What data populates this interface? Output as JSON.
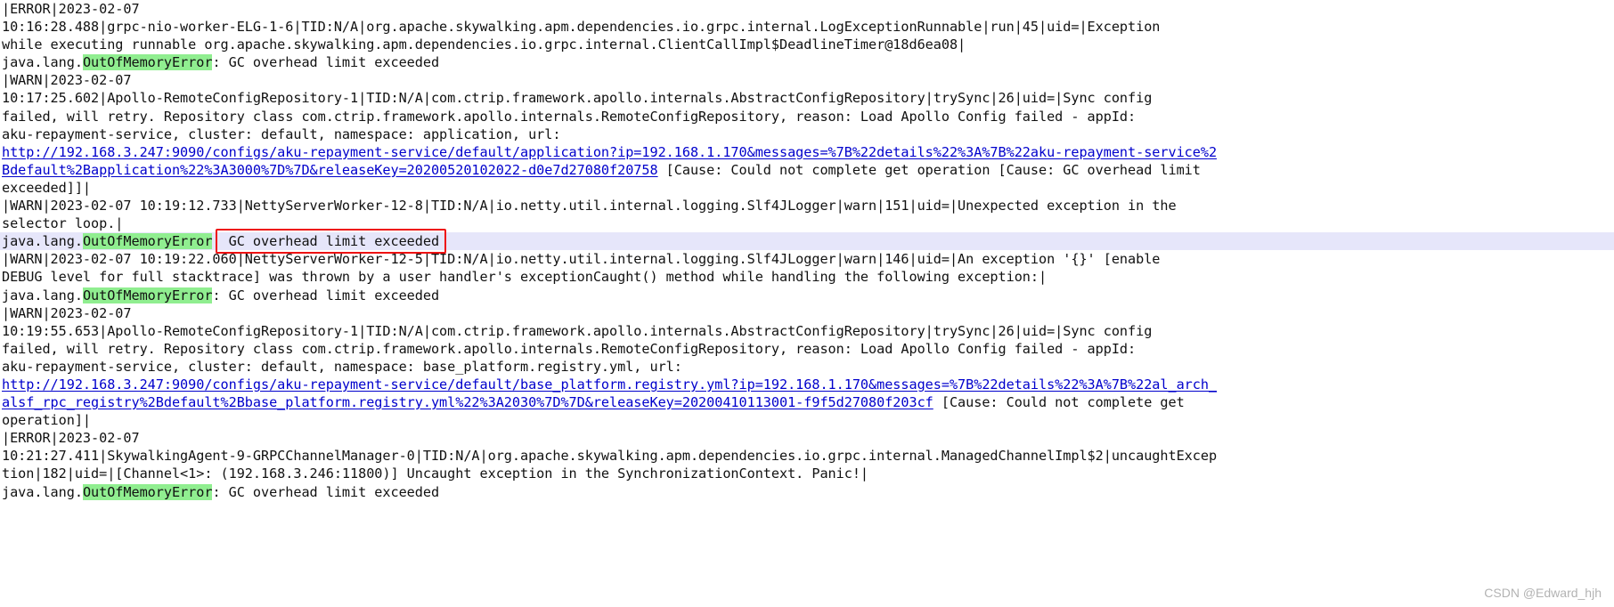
{
  "document": {
    "type": "log-viewer",
    "background_color": "#ffffff",
    "text_color": "#111111",
    "highlight_token_color": "#90ee90",
    "row_highlight_color": "#e6e6fa",
    "url_color": "#0000cc",
    "annotation_box_color": "#ee1111"
  },
  "log": {
    "lines": [
      {
        "id": "l1",
        "text": "|ERROR|2023-02-07"
      },
      {
        "id": "l2",
        "text": "10:16:28.488|grpc-nio-worker-ELG-1-6|TID:N/A|org.apache.skywalking.apm.dependencies.io.grpc.internal.LogExceptionRunnable|run|45|uid=|Exception"
      },
      {
        "id": "l3",
        "text": "while executing runnable org.apache.skywalking.apm.dependencies.io.grpc.internal.ClientCallImpl$DeadlineTimer@18d6ea08|"
      },
      {
        "id": "l4",
        "prefix": "java.lang.",
        "token": "OutOfMemoryError",
        "suffix": ": GC overhead limit exceeded"
      },
      {
        "id": "l5",
        "text": "|WARN|2023-02-07"
      },
      {
        "id": "l6",
        "text": "10:17:25.602|Apollo-RemoteConfigRepository-1|TID:N/A|com.ctrip.framework.apollo.internals.AbstractConfigRepository|trySync|26|uid=|Sync config"
      },
      {
        "id": "l7",
        "text": "failed, will retry. Repository class com.ctrip.framework.apollo.internals.RemoteConfigRepository, reason: Load Apollo Config failed - appId:"
      },
      {
        "id": "l8",
        "text": "aku-repayment-service, cluster: default, namespace: application, url:"
      },
      {
        "id": "l9",
        "url": "http://192.168.3.247:9090/configs/aku-repayment-service/default/application?ip=192.168.1.170&messages=%7B%22details%22%3A%7B%22aku-repayment-service%2"
      },
      {
        "id": "l10",
        "url": "Bdefault%2Bapplication%22%3A3000%7D%7D&releaseKey=20200520102022-d0e7d27080f20758",
        "after": " [Cause: Could not complete get operation [Cause: GC overhead limit"
      },
      {
        "id": "l11",
        "text": "exceeded]]|"
      },
      {
        "id": "l12",
        "text": "|WARN|2023-02-07 10:19:12.733|NettyServerWorker-12-8|TID:N/A|io.netty.util.internal.logging.Slf4JLogger|warn|151|uid=|Unexpected exception in the"
      },
      {
        "id": "l13",
        "text": "selector loop.|"
      },
      {
        "id": "l14",
        "prefix": "java.lang.",
        "token": "OutOfMemoryError",
        "suffix": ": GC overhead limit exceeded",
        "row_highlight": true,
        "annotated": true
      },
      {
        "id": "l15",
        "text": "|WARN|2023-02-07 10:19:22.060|NettyServerWorker-12-5|TID:N/A|io.netty.util.internal.logging.Slf4JLogger|warn|146|uid=|An exception '{}' [enable"
      },
      {
        "id": "l16",
        "text": "DEBUG level for full stacktrace] was thrown by a user handler's exceptionCaught() method while handling the following exception:|"
      },
      {
        "id": "l17",
        "prefix": "java.lang.",
        "token": "OutOfMemoryError",
        "suffix": ": GC overhead limit exceeded"
      },
      {
        "id": "l18",
        "text": "|WARN|2023-02-07"
      },
      {
        "id": "l19",
        "text": "10:19:55.653|Apollo-RemoteConfigRepository-1|TID:N/A|com.ctrip.framework.apollo.internals.AbstractConfigRepository|trySync|26|uid=|Sync config"
      },
      {
        "id": "l20",
        "text": "failed, will retry. Repository class com.ctrip.framework.apollo.internals.RemoteConfigRepository, reason: Load Apollo Config failed - appId:"
      },
      {
        "id": "l21",
        "text": "aku-repayment-service, cluster: default, namespace: base_platform.registry.yml, url:"
      },
      {
        "id": "l22",
        "url": "http://192.168.3.247:9090/configs/aku-repayment-service/default/base_platform.registry.yml?ip=192.168.1.170&messages=%7B%22details%22%3A%7B%22al_arch_"
      },
      {
        "id": "l23",
        "url": "alsf_rpc_registry%2Bdefault%2Bbase_platform.registry.yml%22%3A2030%7D%7D&releaseKey=20200410113001-f9f5d27080f203cf",
        "after": " [Cause: Could not complete get"
      },
      {
        "id": "l24",
        "text": "operation]|"
      },
      {
        "id": "l25",
        "text": "|ERROR|2023-02-07"
      },
      {
        "id": "l26",
        "text": "10:21:27.411|SkywalkingAgent-9-GRPCChannelManager-0|TID:N/A|org.apache.skywalking.apm.dependencies.io.grpc.internal.ManagedChannelImpl$2|uncaughtExcep"
      },
      {
        "id": "l27",
        "text": "tion|182|uid=|[Channel<1>: (192.168.3.246:11800)] Uncaught exception in the SynchronizationContext. Panic!|"
      },
      {
        "id": "l28",
        "prefix": "java.lang.",
        "token": "OutOfMemoryError",
        "suffix": ": GC overhead limit exceeded"
      }
    ]
  },
  "annotation": {
    "label": "GC overhead limit exceeded",
    "target_line_id": "l14",
    "color": "#ee1111"
  },
  "watermark": {
    "text": "CSDN @Edward_hjh"
  }
}
